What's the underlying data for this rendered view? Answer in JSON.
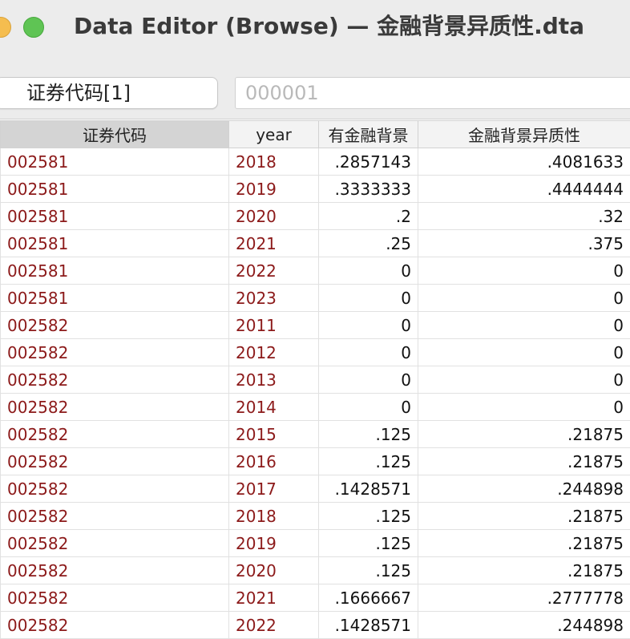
{
  "window": {
    "title": "Data Editor (Browse) — 金融背景异质性.dta"
  },
  "toolbar": {
    "variable_name": "证券代码[1]",
    "cell_value": "000001"
  },
  "table": {
    "columns": [
      "证券代码",
      "year",
      "有金融背景",
      "金融背景异质性"
    ],
    "rows": [
      [
        "002581",
        "2018",
        ".2857143",
        ".4081633"
      ],
      [
        "002581",
        "2019",
        ".3333333",
        ".4444444"
      ],
      [
        "002581",
        "2020",
        ".2",
        ".32"
      ],
      [
        "002581",
        "2021",
        ".25",
        ".375"
      ],
      [
        "002581",
        "2022",
        "0",
        "0"
      ],
      [
        "002581",
        "2023",
        "0",
        "0"
      ],
      [
        "002582",
        "2011",
        "0",
        "0"
      ],
      [
        "002582",
        "2012",
        "0",
        "0"
      ],
      [
        "002582",
        "2013",
        "0",
        "0"
      ],
      [
        "002582",
        "2014",
        "0",
        "0"
      ],
      [
        "002582",
        "2015",
        ".125",
        ".21875"
      ],
      [
        "002582",
        "2016",
        ".125",
        ".21875"
      ],
      [
        "002582",
        "2017",
        ".1428571",
        ".244898"
      ],
      [
        "002582",
        "2018",
        ".125",
        ".21875"
      ],
      [
        "002582",
        "2019",
        ".125",
        ".21875"
      ],
      [
        "002582",
        "2020",
        ".125",
        ".21875"
      ],
      [
        "002582",
        "2021",
        ".1666667",
        ".2777778"
      ],
      [
        "002582",
        "2022",
        ".1428571",
        ".244898"
      ]
    ]
  },
  "colors": {
    "string_text": "#8c1a1a",
    "numeric_text": "#111111",
    "selected_header": "#d4d4d4"
  }
}
